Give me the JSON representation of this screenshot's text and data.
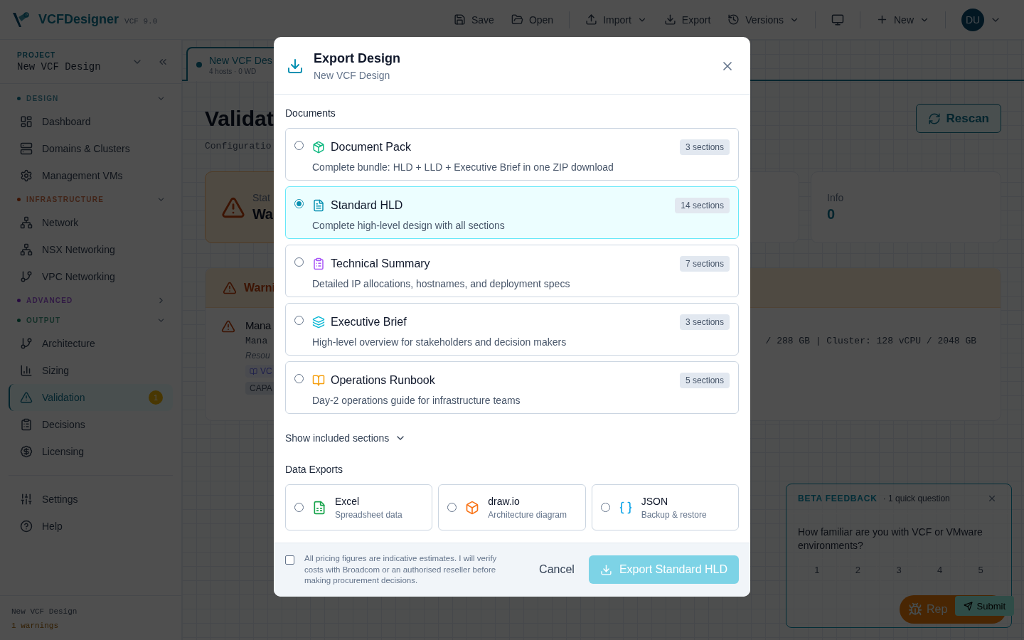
{
  "app": {
    "name": "VCFDesigner",
    "version": "VCF 9.0"
  },
  "toolbar": {
    "groups": [
      [
        {
          "kind": "button",
          "label": "Save",
          "dropdown": false
        },
        {
          "kind": "button",
          "label": "Open",
          "dropdown": false
        }
      ],
      [
        {
          "kind": "button",
          "label": "Import",
          "dropdown": true
        },
        {
          "kind": "button",
          "label": "Export",
          "dropdown": false
        },
        {
          "kind": "button",
          "label": "Versions",
          "dropdown": true
        }
      ],
      [
        {
          "kind": "icon-button",
          "dropdown": false
        }
      ],
      [
        {
          "kind": "button",
          "label": "New",
          "dropdown": true
        }
      ]
    ],
    "user": {
      "initials": "DU"
    }
  },
  "sidebar": {
    "project": {
      "label": "PROJECT",
      "name": "New VCF Design"
    },
    "sections": [
      {
        "label": "DESIGN",
        "expanded": true,
        "items": [
          {
            "label": "Dashboard",
            "selected": false
          },
          {
            "label": "Domains & Clusters",
            "selected": false
          },
          {
            "label": "Management VMs",
            "selected": false
          }
        ]
      },
      {
        "label": "INFRASTRUCTURE",
        "expanded": true,
        "items": [
          {
            "label": "Network",
            "selected": false
          },
          {
            "label": "NSX Networking",
            "selected": false
          },
          {
            "label": "VPC Networking",
            "selected": false
          }
        ]
      },
      {
        "label": "ADVANCED",
        "expanded": false
      },
      {
        "label": "OUTPUT",
        "expanded": true,
        "items": [
          {
            "label": "Architecture",
            "selected": false
          },
          {
            "label": "Sizing",
            "selected": false
          },
          {
            "label": "Validation",
            "selected": true,
            "badge": "1"
          },
          {
            "label": "Decisions",
            "selected": false
          },
          {
            "label": "Licensing",
            "selected": false
          }
        ]
      }
    ],
    "footer_items": [
      {
        "label": "Settings",
        "selected": false
      },
      {
        "label": "Help",
        "selected": false
      }
    ],
    "status": {
      "name": "New VCF Design",
      "warnings": "1 warnings"
    }
  },
  "main": {
    "tab": {
      "title": "New VCF Des",
      "meta": "4 hosts · 0 WD",
      "selected": true
    },
    "title": "Validat",
    "subtitle": "Configuratio",
    "rescan": "Rescan",
    "stat_cards": [
      {
        "kind": "status",
        "label": "Stat",
        "value": "Wa"
      },
      {
        "kind": "blank"
      },
      {
        "kind": "count",
        "label": "Info",
        "value": "0"
      }
    ],
    "warning_panel": {
      "title": "Warni",
      "issues": [
        {
          "title": "Mana",
          "detail": "Mana",
          "detail_tail": "/ 288 GB | Cluster: 128 vCPU / 2048 GB",
          "resource": "Resou",
          "link": "VC",
          "tag": "CAPA"
        }
      ]
    }
  },
  "feedback": {
    "title": "BETA FEEDBACK",
    "subtitle": "· 1 quick question",
    "question": "How familiar are you with VCF or VMware environments?",
    "ratings": [
      {
        "label": "1",
        "selected": false
      },
      {
        "label": "2",
        "selected": false
      },
      {
        "label": "3",
        "selected": false
      },
      {
        "label": "4",
        "selected": false
      },
      {
        "label": "5",
        "selected": false
      }
    ],
    "submit": "Submit",
    "report": "Rep"
  },
  "modal": {
    "title": "Export Design",
    "subtitle": "New VCF Design",
    "documents_label": "Documents",
    "documents": [
      {
        "title": "Document Pack",
        "badge": "3 sections",
        "description": "Complete bundle: HLD + LLD + Executive Brief in one ZIP download",
        "selected": false
      },
      {
        "title": "Standard HLD",
        "badge": "14 sections",
        "description": "Complete high-level design with all sections",
        "selected": true
      },
      {
        "title": "Technical Summary",
        "badge": "7 sections",
        "description": "Detailed IP allocations, hostnames, and deployment specs",
        "selected": false
      },
      {
        "title": "Executive Brief",
        "badge": "3 sections",
        "description": "High-level overview for stakeholders and decision makers",
        "selected": false
      },
      {
        "title": "Operations Runbook",
        "badge": "5 sections",
        "description": "Day-2 operations guide for infrastructure teams",
        "selected": false
      }
    ],
    "show_sections": "Show included sections",
    "data_exports_label": "Data Exports",
    "data_exports": [
      {
        "title": "Excel",
        "description": "Spreadsheet data",
        "selected": false
      },
      {
        "title": "draw.io",
        "description": "Architecture diagram",
        "selected": false
      },
      {
        "title": "JSON",
        "description": "Backup & restore",
        "selected": false
      }
    ],
    "disclaimer": {
      "text": "All pricing figures are indicative estimates. I will verify costs with Broadcom or an authorised reseller before making procurement decisions.",
      "checked": false
    },
    "cancel": "Cancel",
    "export": {
      "label": "Export Standard HLD",
      "disabled": true
    }
  }
}
